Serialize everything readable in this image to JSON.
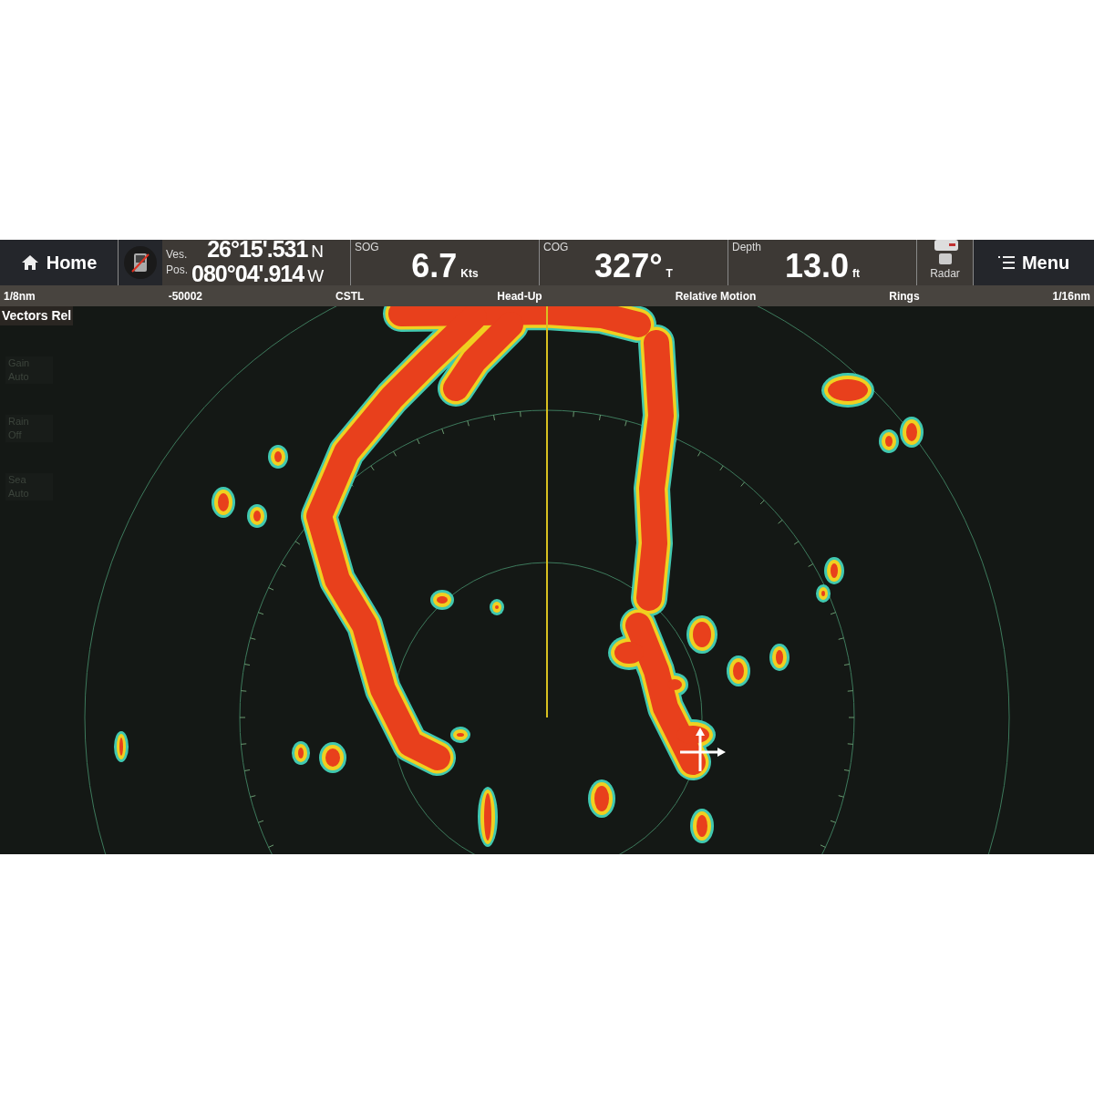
{
  "top_bar": {
    "home_button": {
      "label": "Home"
    },
    "position": {
      "labels": [
        "Ves.",
        "Pos."
      ],
      "lat": {
        "value": "26°15'.531",
        "hemisphere": "N"
      },
      "lon": {
        "value": "080°04'.914",
        "hemisphere": "W"
      }
    },
    "data_boxes": [
      {
        "title": "SOG",
        "value": "6.7",
        "unit": "Kts"
      },
      {
        "title": "COG",
        "value": "327°",
        "unit": "T"
      },
      {
        "title": "Depth",
        "value": "13.0",
        "unit": "ft"
      }
    ],
    "app_button": {
      "label": "Radar"
    },
    "menu_button": {
      "label": "Menu"
    }
  },
  "status_bar": [
    "1/8nm",
    "-50002",
    "CSTL",
    "Head-Up",
    "Relative Motion",
    "Rings",
    "1/16nm"
  ],
  "radar": {
    "vectors_label": "Vectors Rel",
    "controls": [
      {
        "label": "Gain",
        "value": "Auto"
      },
      {
        "label": "Rain",
        "value": "Off"
      },
      {
        "label": "Sea",
        "value": "Auto"
      }
    ]
  }
}
